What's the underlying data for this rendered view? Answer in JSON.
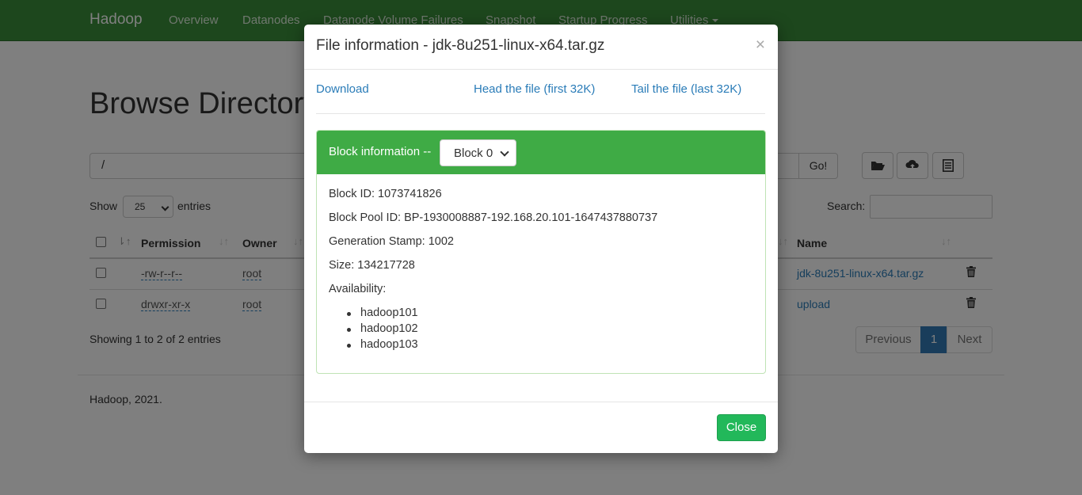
{
  "navbar": {
    "brand": "Hadoop",
    "links": [
      "Overview",
      "Datanodes",
      "Datanode Volume Failures",
      "Snapshot",
      "Startup Progress",
      "Utilities"
    ]
  },
  "browse": {
    "title": "Browse Directory",
    "path": "/",
    "go_label": "Go!",
    "show_label": "Show",
    "entries_value": "25",
    "entries_label": "entries",
    "search_label": "Search:",
    "columns": {
      "permission": "Permission",
      "owner": "Owner",
      "name": "Name"
    },
    "rows": [
      {
        "permission": "-rw-r--r--",
        "owner": "root",
        "name": "jdk-8u251-linux-x64.tar.gz"
      },
      {
        "permission": "drwxr-xr-x",
        "owner": "root",
        "name": "upload"
      }
    ],
    "showing": "Showing 1 to 2 of 2 entries",
    "pagination": {
      "previous": "Previous",
      "current": "1",
      "next": "Next"
    },
    "footer": "Hadoop, 2021."
  },
  "modal": {
    "title": "File information - jdk-8u251-linux-x64.tar.gz",
    "close_x": "×",
    "links": {
      "download": "Download",
      "head": "Head the file (first 32K)",
      "tail": "Tail the file (last 32K)"
    },
    "block_info_label": "Block information --",
    "block_selected": "Block 0",
    "block_id": "Block ID: 1073741826",
    "block_pool_id": "Block Pool ID: BP-1930008887-192.168.20.101-1647437880737",
    "generation_stamp": "Generation Stamp: 1002",
    "size": "Size: 134217728",
    "availability_label": "Availability:",
    "availability": [
      "hadoop101",
      "hadoop102",
      "hadoop103"
    ],
    "close_label": "Close"
  },
  "colors": {
    "navbar": "#3a8f3a",
    "panel_heading": "#3fab45",
    "close_button": "#22b85a",
    "link": "#2a7cb8",
    "pager_active": "#337ab7"
  }
}
